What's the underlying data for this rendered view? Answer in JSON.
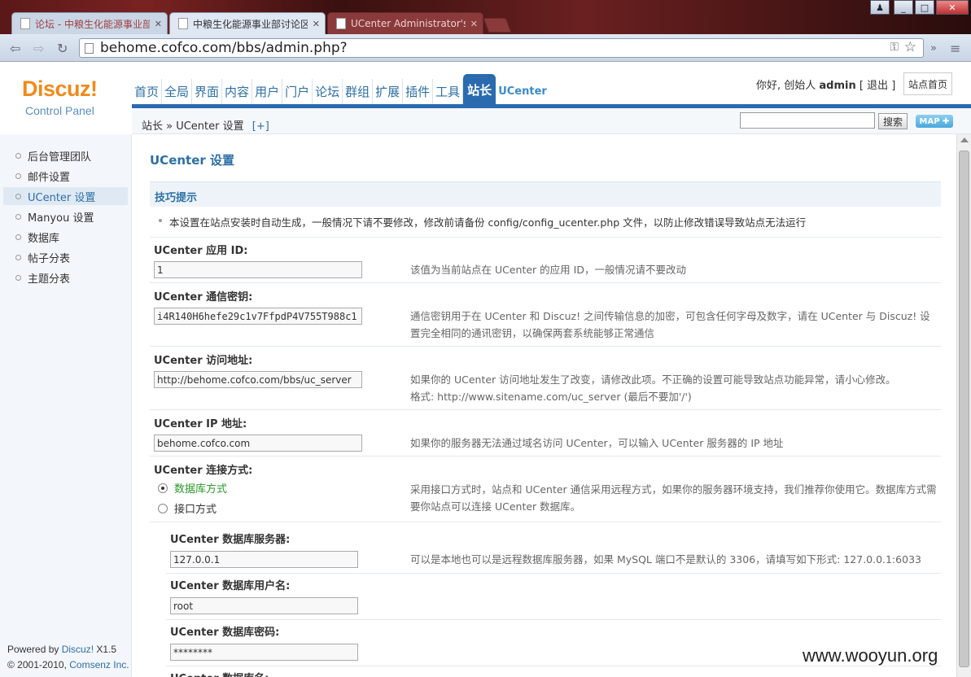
{
  "browser": {
    "tabs": [
      {
        "title": "论坛 - 中粮生化能源事业部"
      },
      {
        "title": "中粮生化能源事业部讨论区"
      },
      {
        "title": "UCenter Administrator's"
      }
    ],
    "url": "behome.cofco.com/bbs/admin.php?",
    "window_controls": {
      "min": "_",
      "max": "□",
      "close": "✕",
      "user": "♟"
    }
  },
  "logo": {
    "brand": "Discuz!",
    "sub": "Control Panel"
  },
  "topnav": [
    "首页",
    "全局",
    "界面",
    "内容",
    "用户",
    "门户",
    "论坛",
    "群组",
    "扩展",
    "插件",
    "工具",
    "站长"
  ],
  "topnav_uc": "UCenter",
  "user": {
    "greeting": "你好, 创始人",
    "name": "admin",
    "logout": "[ 退出 ]",
    "home": "站点首页"
  },
  "breadcrumb": {
    "text": "站长 » UCenter 设置",
    "plus": "[+]"
  },
  "search": {
    "button": "搜索",
    "map": "MAP ✚"
  },
  "sidebar": {
    "items": [
      "后台管理团队",
      "邮件设置",
      "UCenter 设置",
      "Manyou 设置",
      "数据库",
      "帖子分表",
      "主题分表"
    ],
    "powered": "Powered by",
    "powered_brand": "Discuz!",
    "version": "X1.5",
    "copyright": "© 2001-2010,",
    "company": "Comsenz Inc."
  },
  "main": {
    "title": "UCenter 设置",
    "tip_title": "技巧提示",
    "tip": "本设置在站点安装时自动生成，一般情况下请不要修改，修改前请备份 config/config_ucenter.php 文件，以防止修改错误导致站点无法运行",
    "fields": [
      {
        "label": "UCenter 应用 ID:",
        "value": "1",
        "desc": "该值为当前站点在 UCenter 的应用 ID，一般情况请不要改动"
      },
      {
        "label": "UCenter 通信密钥:",
        "value": "i4R140H6hefe29c1v7FfpdP4V755T988c1",
        "desc": "通信密钥用于在 UCenter 和 Discuz! 之间传输信息的加密，可包含任何字母及数字，请在 UCenter 与 Discuz! 设置完全相同的通讯密钥，以确保两套系统能够正常通信"
      },
      {
        "label": "UCenter 访问地址:",
        "value": "http://behome.cofco.com/bbs/uc_server",
        "desc": "如果你的 UCenter 访问地址发生了改变，请修改此项。不正确的设置可能导致站点功能异常，请小心修改。",
        "desc2": "格式: http://www.sitename.com/uc_server (最后不要加'/')"
      },
      {
        "label": "UCenter IP 地址:",
        "value": "behome.cofco.com",
        "desc": "如果你的服务器无法通过域名访问 UCenter，可以输入 UCenter 服务器的 IP 地址"
      },
      {
        "label": "UCenter 连接方式:",
        "desc": "采用接口方式时，站点和 UCenter 通信采用远程方式，如果你的服务器环境支持，我们推荐你使用它。数据库方式需要你站点可以连接 UCenter 数据库。"
      }
    ],
    "connect_options": [
      "数据库方式",
      "接口方式"
    ],
    "db_fields": [
      {
        "label": "UCenter 数据库服务器:",
        "value": "127.0.0.1",
        "desc": "可以是本地也可以是远程数据库服务器，如果 MySQL 端口不是默认的 3306，请填写如下形式: 127.0.0.1:6033"
      },
      {
        "label": "UCenter 数据库用户名:",
        "value": "root"
      },
      {
        "label": "UCenter 数据库密码:",
        "value": "********"
      },
      {
        "label": "UCenter 数据库名:"
      }
    ]
  },
  "watermark": "www.wooyun.org"
}
